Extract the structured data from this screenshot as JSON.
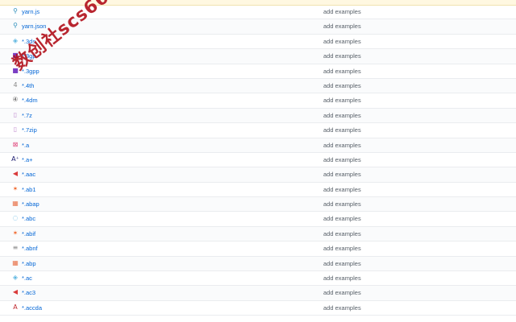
{
  "commit_message": "add examples",
  "files": [
    {
      "name": "yarn.js",
      "icon": "yarn-icon",
      "glyph": "⚲",
      "color": "#2c8ebb"
    },
    {
      "name": "yarn.json",
      "icon": "yarn-icon",
      "glyph": "⚲",
      "color": "#2c8ebb"
    },
    {
      "name": "*.3ds",
      "icon": "cube-3d-icon",
      "glyph": "◈",
      "color": "#5bb5e0"
    },
    {
      "name": "*.3gp",
      "icon": "video-icon",
      "glyph": "■",
      "color": "#7b3fc4"
    },
    {
      "name": "*.3gpp",
      "icon": "video-icon",
      "glyph": "■",
      "color": "#7b3fc4"
    },
    {
      "name": "*.4th",
      "icon": "forth-icon",
      "glyph": "4",
      "color": "#888888"
    },
    {
      "name": "*.4dm",
      "icon": "4d-icon",
      "glyph": "④",
      "color": "#555555"
    },
    {
      "name": "*.7z",
      "icon": "archive-icon",
      "glyph": "▯",
      "color": "#c08cd0"
    },
    {
      "name": "*.7zip",
      "icon": "archive-icon",
      "glyph": "▯",
      "color": "#c08cd0"
    },
    {
      "name": "*.a",
      "icon": "binary-icon",
      "glyph": "⊠",
      "color": "#e0457b"
    },
    {
      "name": "*.a+",
      "icon": "a-plus-icon",
      "glyph": "A⁺",
      "color": "#1a1a70"
    },
    {
      "name": "*.aac",
      "icon": "audio-icon",
      "glyph": "◀",
      "color": "#d93b3b"
    },
    {
      "name": "*.ab1",
      "icon": "dna-icon",
      "glyph": "✶",
      "color": "#f06529"
    },
    {
      "name": "*.abap",
      "icon": "abap-icon",
      "glyph": "▦",
      "color": "#e8744c"
    },
    {
      "name": "*.abc",
      "icon": "abc-icon",
      "glyph": "◌",
      "color": "#5bb5e0"
    },
    {
      "name": "*.abif",
      "icon": "dna-icon",
      "glyph": "✶",
      "color": "#f06529"
    },
    {
      "name": "*.abnf",
      "icon": "grammar-icon",
      "glyph": "≡",
      "color": "#888888"
    },
    {
      "name": "*.abp",
      "icon": "abap-icon",
      "glyph": "▦",
      "color": "#e8744c"
    },
    {
      "name": "*.ac",
      "icon": "autoconf-icon",
      "glyph": "◈",
      "color": "#5bb5e0"
    },
    {
      "name": "*.ac3",
      "icon": "audio-icon",
      "glyph": "◀",
      "color": "#d93b3b"
    },
    {
      "name": "*.accda",
      "icon": "access-icon",
      "glyph": "A",
      "color": "#c0282e"
    }
  ],
  "watermark": {
    "text": "数创社scs66",
    "color": "#b3141f"
  }
}
